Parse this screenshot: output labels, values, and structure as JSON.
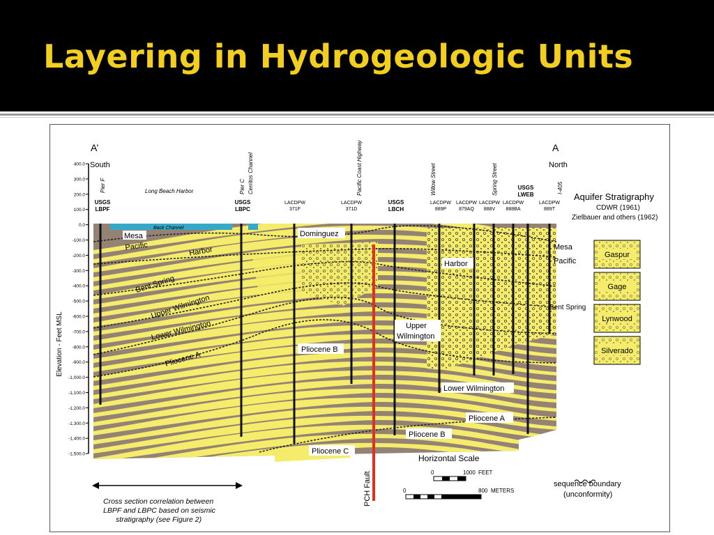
{
  "slide": {
    "title": "Layering in Hydrogeologic Units"
  },
  "figure": {
    "ends": {
      "left_letter": "A’",
      "right_letter": "A",
      "left_dir": "South",
      "right_dir": "North"
    },
    "yaxis": {
      "label": "Elevation - Feet MSL",
      "ticks": [
        "400.0",
        "300.0",
        "200.0",
        "100.0",
        "0.0",
        "-100.0",
        "-200.0",
        "-300.0",
        "-400.0",
        "-500.0",
        "-600.0",
        "-700.0",
        "-800.0",
        "-900.0",
        "-1,000.0",
        "-1,100.0",
        "-1,200.0",
        "-1,300.0",
        "-1,400.0",
        "-1,500.0"
      ]
    },
    "top_labels": {
      "pier_f": "Pier F",
      "long_beach_harbor": "Long Beach Harbor",
      "pier_c": "Pier C",
      "cerritos": "Cerritos Channel",
      "pch": "Pacific Coast Highway",
      "willow": "Willow Street",
      "spring": "Spring Street",
      "i405": "I-405"
    },
    "wells": {
      "lbpf_1": "USGS",
      "lbpf_2": "LBPF",
      "lbpc_1": "USGS",
      "lbpc_2": "LBPC",
      "w371f_1": "LACDPW",
      "w371f_2": "371F",
      "w371d_1": "LACDPW",
      "w371d_2": "371D",
      "lbch_1": "USGS",
      "lbch_2": "LBCH",
      "w889p_1": "LACDPW",
      "w889p_2": "889P",
      "w879aq_1": "LACDPW",
      "w879aq_2": "879AQ",
      "w888v_1": "LACDPW",
      "w888v_2": "888V",
      "lweb_1": "USGS",
      "lweb_2": "LWEB",
      "w888ba_1": "LACDPW",
      "w888ba_2": "888BA",
      "w889t_1": "LACDPW",
      "w889t_2": "889T"
    },
    "units": {
      "back_channel": "Back Channel",
      "mesa_l": "Mesa",
      "pacific_l": "Pacific",
      "harbor_l": "Harbor",
      "bent_l": "Bent Spring",
      "upper_wil_l": "Upper Wilmington",
      "lower_wil_l": "Lower Wilmington",
      "plio_a_l": "Pliocene A",
      "dominguez": "Dominguez",
      "plio_b_c": "Pliocene B",
      "plio_c": "Pliocene C",
      "harbor_r": "Harbor",
      "upper_r1": "Upper",
      "upper_r2": "Wilmington",
      "lower_wil_r": "Lower Wilmington",
      "plio_a_r": "Pliocene A",
      "plio_b_r": "Pliocene B",
      "mesa_r": "Mesa",
      "pacific_r": "Pacific",
      "bent_r": "Bent Spring"
    },
    "fault": "PCH Fault",
    "legend": {
      "title": "Aquifer Stratigraphy",
      "line1": "CDWR (1961)",
      "line2": "Zielbauer and others (1962)",
      "items": [
        "Gaspur",
        "Gage",
        "Lynwood",
        "Silverado"
      ],
      "seq1": "sequence boundary",
      "seq2": "(unconformity)"
    },
    "scale": {
      "title": "Horizontal Scale",
      "ft0": "0",
      "ft1": "1000",
      "ft_unit": "FEET",
      "m0": "0",
      "m1": "800",
      "m_unit": "METERS"
    },
    "note": {
      "l1": "Cross section correlation between",
      "l2": "LBPF and LBPC based on seismic",
      "l3": "stratigraphy (see Figure 2)"
    },
    "colors": {
      "clay": "#948374",
      "sand": "#f4ec6a",
      "fault": "#e0301e",
      "water": "#36a8c8",
      "title": "#f2cf1e"
    }
  }
}
